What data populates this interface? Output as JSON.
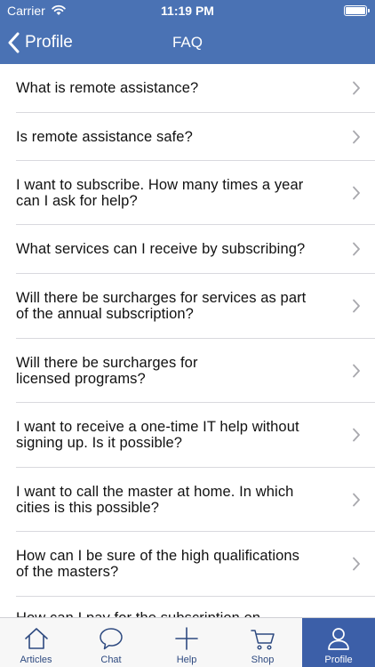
{
  "status_bar": {
    "carrier": "Carrier",
    "time": "11:19 PM"
  },
  "nav": {
    "back_label": "Profile",
    "title": "FAQ"
  },
  "faq": [
    {
      "line1": "What is remote assistance?",
      "line2": ""
    },
    {
      "line1": "Is remote assistance safe?",
      "line2": ""
    },
    {
      "line1": "I want to subscribe. How many times a year",
      "line2": "can I ask for help?"
    },
    {
      "line1": "What services can I receive by subscribing?",
      "line2": ""
    },
    {
      "line1": "Will there be surcharges for services as part",
      "line2": "of the annual subscription?"
    },
    {
      "line1": "Will there be surcharges for",
      "line2": "licensed programs?"
    },
    {
      "line1": "I want to receive a one-time IT help without",
      "line2": "signing up. Is it possible?"
    },
    {
      "line1": "I want to call the master at home. In which",
      "line2": "cities is this possible?"
    },
    {
      "line1": "How can I be sure of the high qualifications",
      "line2": "of the masters?"
    },
    {
      "line1": "How can I pay for the subscription on",
      "line2": ""
    }
  ],
  "tabs": [
    {
      "label": "Articles",
      "icon": "house-icon"
    },
    {
      "label": "Chat",
      "icon": "chat-bubble-icon"
    },
    {
      "label": "Help",
      "icon": "plus-icon"
    },
    {
      "label": "Shop",
      "icon": "cart-icon"
    },
    {
      "label": "Profile",
      "icon": "person-icon",
      "active": true
    }
  ],
  "colors": {
    "header": "#4a72b4",
    "tab_active": "#3c5fa8",
    "tab_label": "#2e4a80"
  }
}
